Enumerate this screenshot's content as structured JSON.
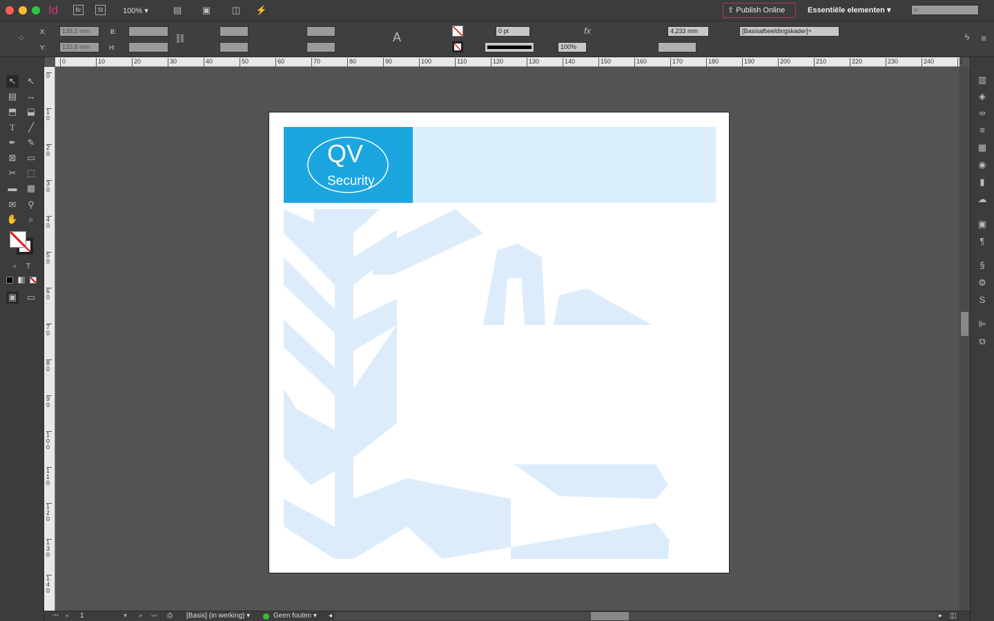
{
  "app": {
    "logo": "Id",
    "bridge": "Br",
    "stock": "St",
    "zoom": "100%",
    "publish_online": "Publish Online",
    "workspace": "Essentiële elementen",
    "search_placeholder": ""
  },
  "control": {
    "x_label": "X:",
    "x_value": "138,2 mm",
    "y_label": "Y:",
    "y_value": "132,8 mm",
    "w_label": "B:",
    "h_label": "H:",
    "stroke_weight": "0 pt",
    "opacity": "100%",
    "corner_size": "4,233 mm",
    "object_style": "[Basisafbeeldingskader]+"
  },
  "rulers": {
    "horizontal": [
      "0",
      "10",
      "20",
      "30",
      "40",
      "50",
      "60",
      "70",
      "80",
      "90",
      "100",
      "110",
      "120",
      "130",
      "140",
      "150",
      "160",
      "170",
      "180",
      "190",
      "200",
      "210",
      "220",
      "230",
      "240",
      "2"
    ],
    "vertical": [
      "0",
      "10",
      "20",
      "30",
      "40",
      "50",
      "60",
      "70",
      "80",
      "90",
      "100",
      "110",
      "120",
      "130",
      "140"
    ]
  },
  "document": {
    "logo_text_top": "QV",
    "logo_text_bottom": "Security",
    "brand_color": "#1ba6e0",
    "band_color": "#dbeefb",
    "pattern_color": "#dcecfa"
  },
  "status": {
    "page": "1",
    "master": "[Basis] (in werking)",
    "preflight": "Geen fouten",
    "preflight_color": "#3cb83c"
  }
}
